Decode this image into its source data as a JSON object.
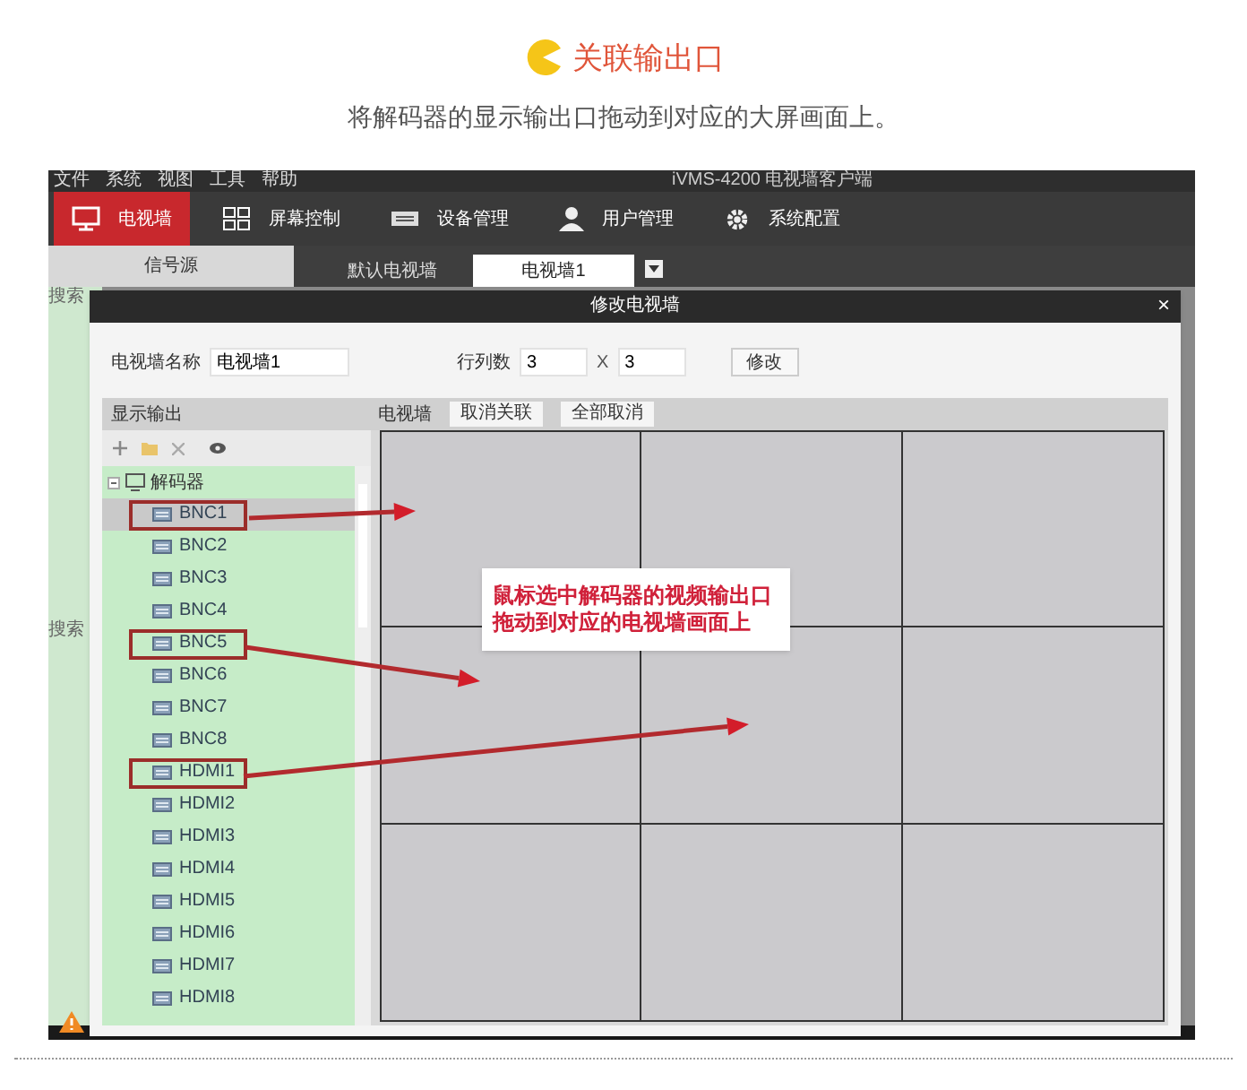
{
  "article": {
    "title": "关联输出口",
    "subtitle": "将解码器的显示输出口拖动到对应的大屏画面上。"
  },
  "app": {
    "menu": [
      "文件",
      "系统",
      "视图",
      "工具",
      "帮助"
    ],
    "title": "iVMS-4200 电视墙客户端",
    "nav": [
      {
        "label": "电视墙",
        "kind": "wall",
        "selected": true
      },
      {
        "label": "屏幕控制",
        "kind": "grid",
        "selected": false
      },
      {
        "label": "设备管理",
        "kind": "device",
        "selected": false
      },
      {
        "label": "用户管理",
        "kind": "user",
        "selected": false
      },
      {
        "label": "系统配置",
        "kind": "gear",
        "selected": false
      }
    ],
    "source_label": "信号源",
    "wall_tabs": [
      {
        "label": "默认电视墙",
        "selected": false
      },
      {
        "label": "电视墙1",
        "selected": true
      }
    ],
    "side_labels": [
      "搜索",
      "搜索"
    ]
  },
  "dialog": {
    "title": "修改电视墙",
    "close": "×",
    "name_label": "电视墙名称",
    "name_value": "电视墙1",
    "grid_label": "行列数",
    "rows_value": "3",
    "times": "X",
    "cols_value": "3",
    "modify_button": "修改",
    "output_panel": {
      "title": "显示输出",
      "tree": [
        {
          "label": "解码器",
          "expanded": true,
          "children": [
            {
              "label": "BNC1",
              "selected": true,
              "annotated": true
            },
            {
              "label": "BNC2",
              "selected": false,
              "annotated": false
            },
            {
              "label": "BNC3",
              "selected": false,
              "annotated": false
            },
            {
              "label": "BNC4",
              "selected": false,
              "annotated": false
            },
            {
              "label": "BNC5",
              "selected": false,
              "annotated": true
            },
            {
              "label": "BNC6",
              "selected": false,
              "annotated": false
            },
            {
              "label": "BNC7",
              "selected": false,
              "annotated": false
            },
            {
              "label": "BNC8",
              "selected": false,
              "annotated": false
            },
            {
              "label": "HDMI1",
              "selected": false,
              "annotated": true
            },
            {
              "label": "HDMI2",
              "selected": false,
              "annotated": false
            },
            {
              "label": "HDMI3",
              "selected": false,
              "annotated": false
            },
            {
              "label": "HDMI4",
              "selected": false,
              "annotated": false
            },
            {
              "label": "HDMI5",
              "selected": false,
              "annotated": false
            },
            {
              "label": "HDMI6",
              "selected": false,
              "annotated": false
            },
            {
              "label": "HDMI7",
              "selected": false,
              "annotated": false
            },
            {
              "label": "HDMI8",
              "selected": false,
              "annotated": false
            }
          ]
        }
      ]
    },
    "wall_panel": {
      "label": "电视墙",
      "buttons": [
        "取消关联",
        "全部取消"
      ]
    },
    "callout": [
      "鼠标选中解码器的视频输出口",
      "拖动到对应的电视墙画面上"
    ]
  }
}
